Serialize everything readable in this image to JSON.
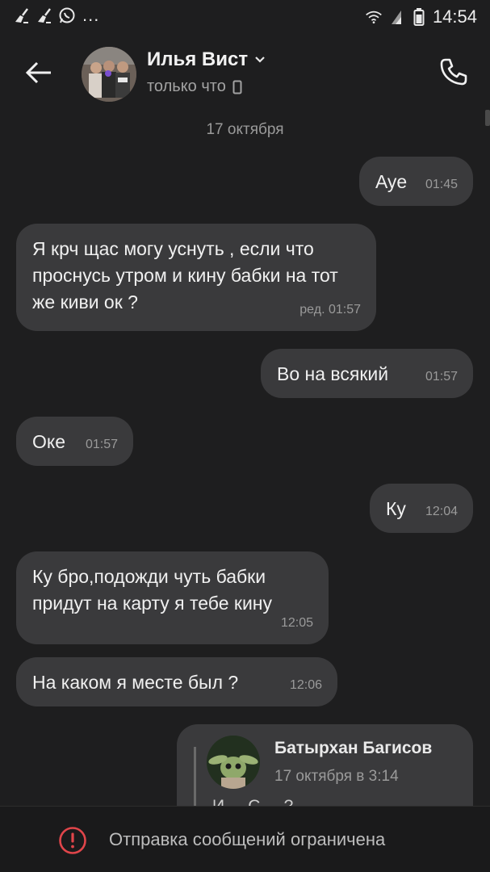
{
  "status_bar": {
    "time": "14:54",
    "left_icons": [
      "broom-icon",
      "broom-icon",
      "whatsapp-icon"
    ],
    "overflow": "...",
    "right_icons": [
      "wifi-icon",
      "signal-icon",
      "battery-icon"
    ]
  },
  "header": {
    "contact_name": "Илья Вист",
    "status": "только что",
    "status_device_icon": "phone-device-icon"
  },
  "date_separator": "17 октября",
  "messages": [
    {
      "direction": "out",
      "text": "Aye",
      "time": "01:45"
    },
    {
      "direction": "in",
      "text": "Я крч щас могу уснуть , если что проснусь утром и кину бабки на тот же киви ок ?",
      "time": "ред. 01:57"
    },
    {
      "direction": "out",
      "text": "Во на всякий",
      "time": "01:57"
    },
    {
      "direction": "in",
      "text": "Оке",
      "time": "01:57"
    },
    {
      "direction": "out",
      "text": "Ку",
      "time": "12:04"
    },
    {
      "direction": "in",
      "text": "Ку бро,подожди чуть бабки придут на карту я тебе кину",
      "time": "12:05"
    },
    {
      "direction": "in",
      "text": "На каком я месте был ?",
      "time": "12:06"
    }
  ],
  "quoted_message": {
    "author": "Батырхан Багисов",
    "date": "17 октября в 3:14",
    "preview": "И ... С ... ?"
  },
  "bottom_bar": {
    "restricted_text": "Отправка сообщений ограничена"
  },
  "colors": {
    "background": "#1e1e1f",
    "bubble": "#3a3a3c",
    "warning": "#e0454a"
  }
}
